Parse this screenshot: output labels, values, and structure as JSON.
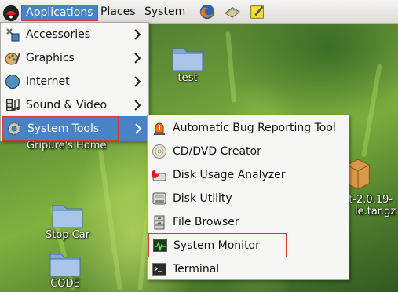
{
  "panel": {
    "applications_label": "Applications",
    "places_label": "Places",
    "system_label": "System"
  },
  "main_menu": {
    "items": [
      {
        "label": "Accessories"
      },
      {
        "label": "Graphics"
      },
      {
        "label": "Internet"
      },
      {
        "label": "Sound & Video"
      },
      {
        "label": "System Tools"
      }
    ]
  },
  "submenu": {
    "items": [
      {
        "label": "Automatic Bug Reporting Tool"
      },
      {
        "label": "CD/DVD Creator"
      },
      {
        "label": "Disk Usage Analyzer"
      },
      {
        "label": "Disk Utility"
      },
      {
        "label": "File Browser"
      },
      {
        "label": "System Monitor"
      },
      {
        "label": "Terminal"
      }
    ]
  },
  "desktop": {
    "icons": [
      {
        "label": "test"
      },
      {
        "label": "Gripure's Home"
      },
      {
        "label": "Stop Car"
      },
      {
        "label": "CODE"
      },
      {
        "label_line1": "nt-2.0.19-",
        "label_line2": "le.tar.gz"
      }
    ]
  },
  "colors": {
    "highlight": "#4a82c6",
    "annotation_outline": "#d9363e",
    "menu_bg": "#f6f6f4"
  }
}
